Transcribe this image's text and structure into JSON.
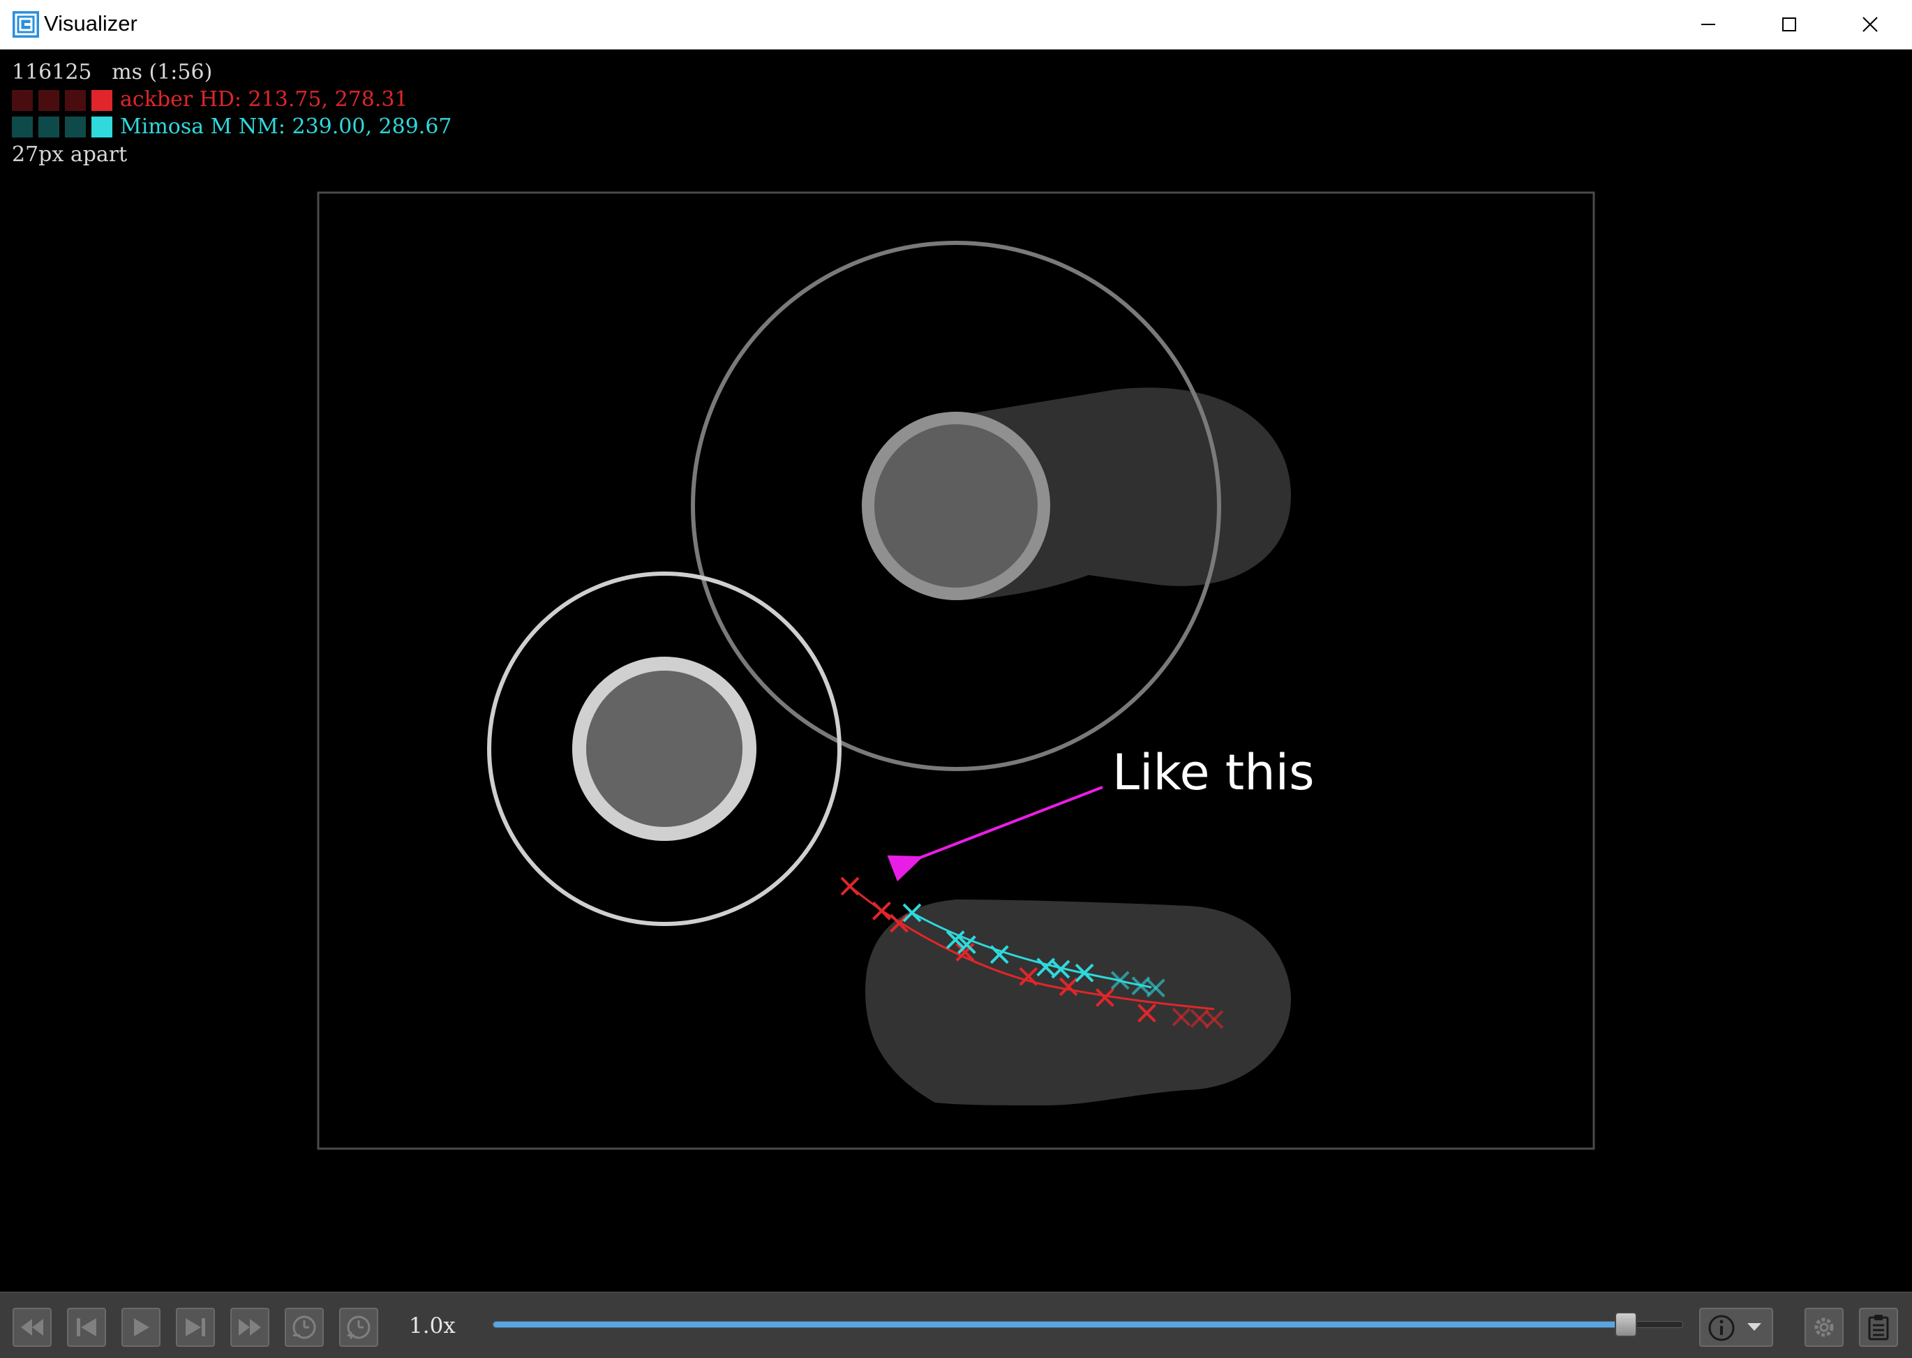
{
  "window": {
    "title": "Visualizer",
    "icons": {
      "app": "visualizer-app-icon",
      "minimize": "minimize-icon",
      "maximize": "maximize-icon",
      "close": "close-icon"
    }
  },
  "overlay": {
    "time_line": "116125   ms (1:56)",
    "players": [
      {
        "label": "ackber HD: 213.75, 278.31",
        "color": "#e0262a",
        "swatch_colors": [
          "#4a0d0f",
          "#4a0d0f",
          "#4a0d0f",
          "#e0262a"
        ]
      },
      {
        "label": "Mimosa M NM: 239.00, 289.67",
        "color": "#2fd9dc",
        "swatch_colors": [
          "#0f4a4a",
          "#0f4a4a",
          "#0f4a4a",
          "#2fd9dc"
        ]
      }
    ],
    "distance_line": "27px apart"
  },
  "annotation": {
    "text": "Like this",
    "color": "#e91ee6"
  },
  "cursor_trails": {
    "red": {
      "color": "#e0262a",
      "markers": [
        [
          0.0,
          0.0
        ],
        [
          0.087,
          0.07
        ],
        [
          0.135,
          0.105
        ],
        [
          0.316,
          0.187
        ],
        [
          0.49,
          0.256
        ],
        [
          0.6,
          0.285
        ],
        [
          0.7,
          0.316
        ],
        [
          0.815,
          0.36
        ],
        [
          0.91,
          0.371
        ],
        [
          0.96,
          0.375
        ],
        [
          1.0,
          0.378
        ]
      ]
    },
    "cyan": {
      "color": "#2fd9dc",
      "markers": [
        [
          0.0,
          0.0
        ],
        [
          0.146,
          0.088
        ],
        [
          0.184,
          0.104
        ],
        [
          0.294,
          0.136
        ],
        [
          0.45,
          0.177
        ],
        [
          0.5,
          0.184
        ],
        [
          0.58,
          0.196
        ],
        [
          0.7,
          0.22
        ],
        [
          0.77,
          0.238
        ],
        [
          0.82,
          0.245
        ]
      ]
    }
  },
  "toolbar": {
    "buttons": [
      {
        "name": "rewind-button",
        "icon": "rewind-icon"
      },
      {
        "name": "step-back-button",
        "icon": "skip-back-icon"
      },
      {
        "name": "play-button",
        "icon": "play-icon"
      },
      {
        "name": "step-forward-button",
        "icon": "skip-forward-icon"
      },
      {
        "name": "fast-forward-button",
        "icon": "fast-forward-icon"
      },
      {
        "name": "slower-button",
        "icon": "clock-minus-icon"
      },
      {
        "name": "faster-button",
        "icon": "clock-plus-icon"
      }
    ],
    "speed": "1.0x",
    "seek_progress": 0.952,
    "right_buttons": [
      {
        "name": "info-dropdown-button",
        "icon": "info-icon"
      },
      {
        "name": "settings-button",
        "icon": "gear-icon"
      },
      {
        "name": "clipboard-button",
        "icon": "clipboard-icon"
      }
    ]
  }
}
